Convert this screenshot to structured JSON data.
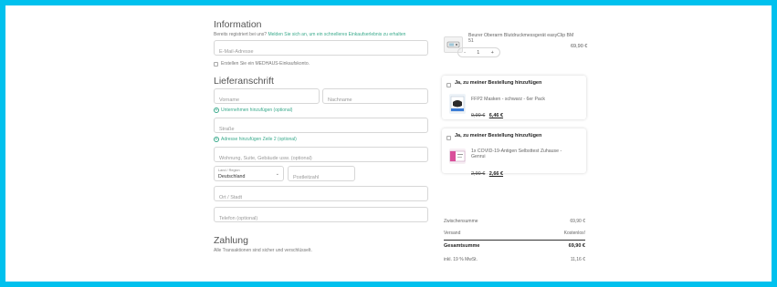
{
  "information": {
    "heading": "Information",
    "registered_prefix": "Bereits registriert bei uns?",
    "registered_link": "Melden Sie sich an, um ein schnelleres Einkaufserlebnis zu erhalten",
    "email_placeholder": "E-Mail-Adresse",
    "create_account_label": "Erstellen Sie ein MEDHAUS-Einkaufskonto."
  },
  "shipping": {
    "heading": "Lieferanschrift",
    "first_name_placeholder": "Vorname",
    "last_name_placeholder": "Nachname",
    "add_company_label": "Unternehmen hinzufügen (optional)",
    "street_placeholder": "Straße",
    "add_address_line_label": "Adresse hinzufügen Zeile 2 (optional)",
    "apartment_placeholder": "Wohnung, Suite, Gebäude usw. (optional)",
    "country_label": "Land / Region",
    "country_value": "Deutschland",
    "postal_placeholder": "Postleitzahl",
    "city_placeholder": "Ort / Stadt",
    "phone_placeholder": "Telefon (optional)"
  },
  "payment": {
    "heading": "Zahlung",
    "note": "Alle Transaktionen sind sicher und verschlüsselt."
  },
  "cart": {
    "item_name": "Beurer Oberarm Blutdruckmessgerät easyClip BM 51",
    "item_price": "69,90 €",
    "quantity": "1",
    "minus": "-",
    "plus": "+"
  },
  "upsells": [
    {
      "title": "Ja, zu meiner Bestellung hinzufügen",
      "name": "FFP2 Masken - schwarz - 6er Pack",
      "old_price": "9,90 €",
      "new_price": "6,46 €"
    },
    {
      "title": "Ja, zu meiner Bestellung hinzufügen",
      "name": "1x COVID-19-Antigen Selbsttest Zuhause - Genrui",
      "old_price": "2,90 €",
      "new_price": "2,66 €"
    }
  ],
  "summary": {
    "subtotal_label": "Zwischensumme",
    "subtotal_value": "69,90 €",
    "shipping_label": "Versand",
    "shipping_value": "Kostenlos!",
    "total_label": "Gesamtsumme",
    "total_value": "69,90 €",
    "vat_label": "inkl. 19 % MwSt.",
    "vat_value": "11,16 €"
  }
}
